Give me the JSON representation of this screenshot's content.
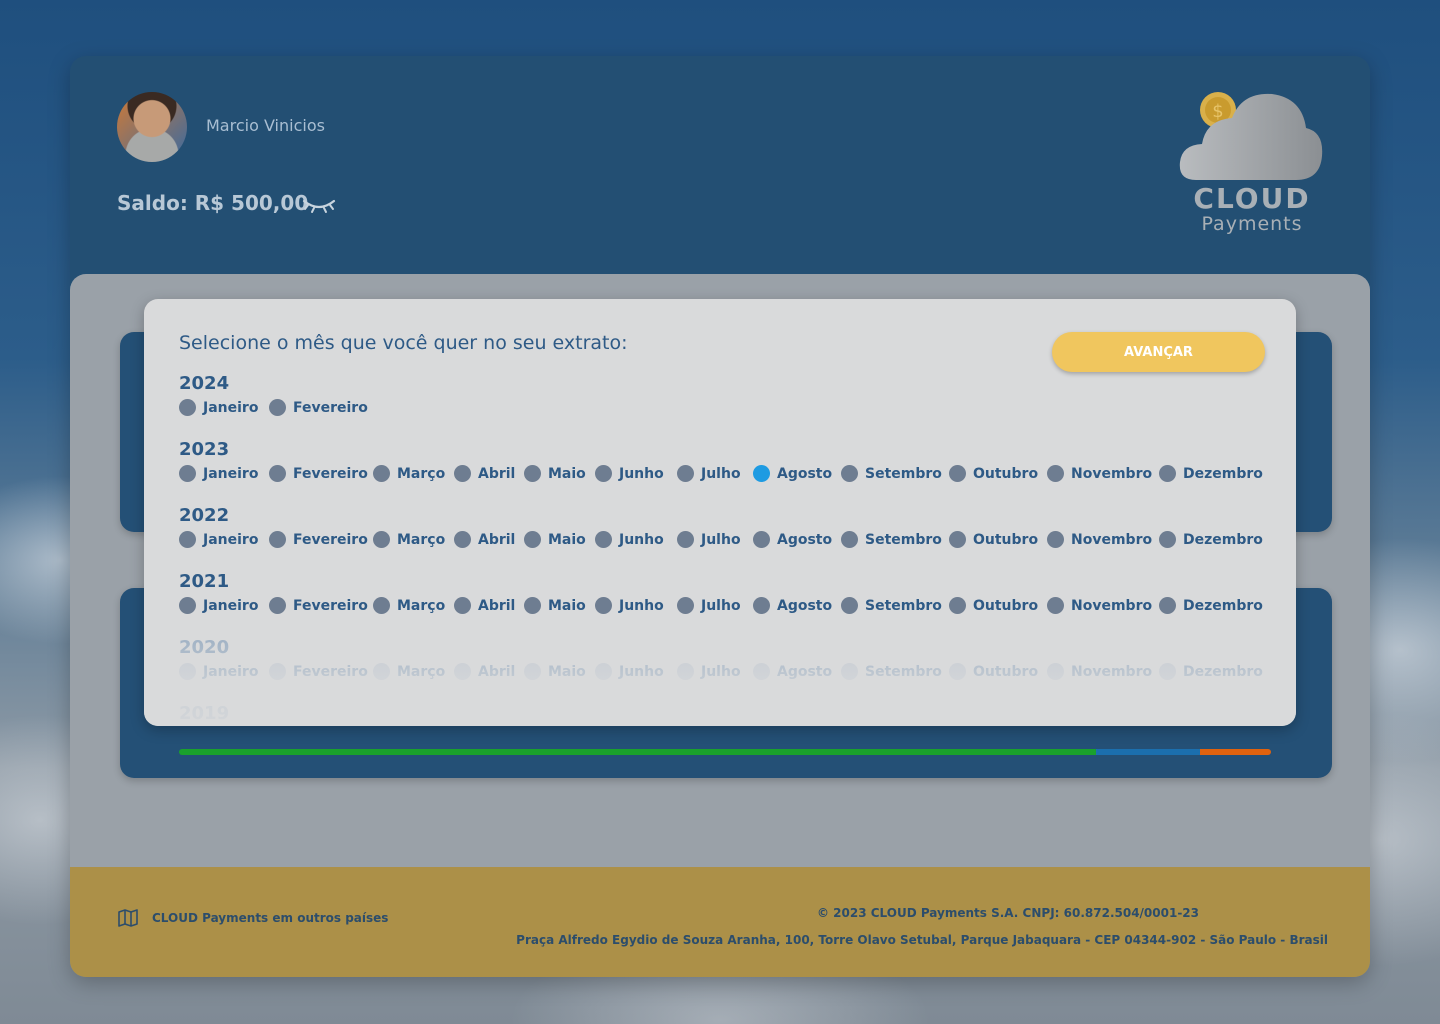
{
  "user": {
    "name": "Marcio Vinicios",
    "balance_label": "Saldo: R$ 500,00"
  },
  "brand": {
    "name_line1": "CLOUD",
    "name_line2": "Payments"
  },
  "modal": {
    "title": "Selecione o mês que você quer no seu extrato:",
    "advance_label": "AVANÇAR",
    "years": [
      {
        "year": "2024",
        "months": [
          "Janeiro",
          "Fevereiro"
        ],
        "selected": -1
      },
      {
        "year": "2023",
        "months": [
          "Janeiro",
          "Fevereiro",
          "Março",
          "Abril",
          "Maio",
          "Junho",
          "Julho",
          "Agosto",
          "Setembro",
          "Outubro",
          "Novembro",
          "Dezembro"
        ],
        "selected": 7
      },
      {
        "year": "2022",
        "months": [
          "Janeiro",
          "Fevereiro",
          "Março",
          "Abril",
          "Maio",
          "Junho",
          "Julho",
          "Agosto",
          "Setembro",
          "Outubro",
          "Novembro",
          "Dezembro"
        ],
        "selected": -1
      },
      {
        "year": "2021",
        "months": [
          "Janeiro",
          "Fevereiro",
          "Março",
          "Abril",
          "Maio",
          "Junho",
          "Julho",
          "Agosto",
          "Setembro",
          "Outubro",
          "Novembro",
          "Dezembro"
        ],
        "selected": -1
      },
      {
        "year": "2020",
        "months": [
          "Janeiro",
          "Fevereiro",
          "Março",
          "Abril",
          "Maio",
          "Junho",
          "Julho",
          "Agosto",
          "Setembro",
          "Outubro",
          "Novembro",
          "Dezembro"
        ],
        "selected": -1
      },
      {
        "year": "2019",
        "months": [],
        "selected": -1
      }
    ]
  },
  "progress": {
    "segments": [
      {
        "color": "#1aa12c",
        "fraction": 0.84
      },
      {
        "color": "#1b6fae",
        "fraction": 0.095
      },
      {
        "color": "#e0620e",
        "fraction": 0.065
      }
    ]
  },
  "footer": {
    "other_countries_label": "CLOUD Payments em outros países",
    "copyright": "© 2023 CLOUD Payments S.A. CNPJ: 60.872.504/0001-23",
    "address": "Praça Alfredo Egydio de Souza Aranha, 100, Torre Olavo Setubal, Parque Jabaquara - CEP 04344-902 - São Paulo - Brasil"
  },
  "colors": {
    "accent": "#f0c65e",
    "primary": "#234f73",
    "selected_radio": "#1e9be2",
    "footer": "#ac9048"
  }
}
